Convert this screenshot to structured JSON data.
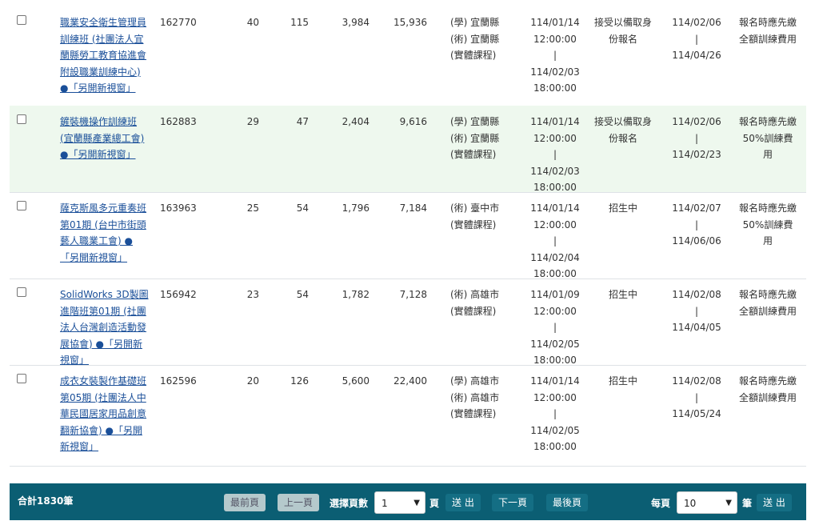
{
  "rows": [
    {
      "name": "職業安全衛生管理員訓練班 (社團法人宜蘭縣勞工教育協進會附設職業訓練中心) ●「另開新視窗」",
      "id": "162770",
      "a": "40",
      "b": "115",
      "c": "3,984",
      "d": "15,936",
      "loc": [
        "(學) 宜蘭縣",
        "(術) 宜蘭縣",
        "(實體課程)"
      ],
      "date": [
        "114/01/14",
        "12:00:00",
        "|",
        "114/02/03",
        "18:00:00"
      ],
      "status": "接受以備取身份報名",
      "period": [
        "114/02/06",
        "|",
        "114/04/26"
      ],
      "pay": "報名時應先繳全額訓練費用"
    },
    {
      "name": "鏟裝機操作訓練班 (宜蘭縣產業總工會) ●「另開新視窗」",
      "id": "162883",
      "a": "29",
      "b": "47",
      "c": "2,404",
      "d": "9,616",
      "loc": [
        "(學) 宜蘭縣",
        "(術) 宜蘭縣",
        "(實體課程)"
      ],
      "date": [
        "114/01/14",
        "12:00:00",
        "|",
        "114/02/03",
        "18:00:00"
      ],
      "status": "接受以備取身份報名",
      "period": [
        "114/02/06",
        "|",
        "114/02/23"
      ],
      "pay": "報名時應先繳50%訓練費用"
    },
    {
      "name": "薩克斯風多元重奏班第01期 (台中市街頭藝人職業工會) ●「另開新視窗」",
      "id": "163963",
      "a": "25",
      "b": "54",
      "c": "1,796",
      "d": "7,184",
      "loc": [
        "(術) 臺中市",
        "(實體課程)"
      ],
      "date": [
        "114/01/14",
        "12:00:00",
        "|",
        "114/02/04",
        "18:00:00"
      ],
      "status": "招生中",
      "period": [
        "114/02/07",
        "|",
        "114/06/06"
      ],
      "pay": "報名時應先繳50%訓練費用"
    },
    {
      "name": "SolidWorks 3D製圖進階班第01期 (社團法人台灣創造活動發展協會) ●「另開新視窗」",
      "id": "156942",
      "a": "23",
      "b": "54",
      "c": "1,782",
      "d": "7,128",
      "loc": [
        "(術) 高雄市",
        "(實體課程)"
      ],
      "date": [
        "114/01/09",
        "12:00:00",
        "|",
        "114/02/05",
        "18:00:00"
      ],
      "status": "招生中",
      "period": [
        "114/02/08",
        "|",
        "114/04/05"
      ],
      "pay": "報名時應先繳全額訓練費用"
    },
    {
      "name": "成衣女裝製作基礎班第05期 (社團法人中華民國居家用品創意翻新協會) ●「另開新視窗」",
      "id": "162596",
      "a": "20",
      "b": "126",
      "c": "5,600",
      "d": "22,400",
      "loc": [
        "(學) 高雄市",
        "(術) 高雄市",
        "(實體課程)"
      ],
      "date": [
        "114/01/14",
        "12:00:00",
        "|",
        "114/02/05",
        "18:00:00"
      ],
      "status": "招生中",
      "period": [
        "114/02/08",
        "|",
        "114/05/24"
      ],
      "pay": "報名時應先繳全額訓練費用"
    }
  ],
  "pager": {
    "total": "合計1830筆",
    "first": "最前頁",
    "prev": "上一頁",
    "select_label": "選擇頁數",
    "page_value": "1",
    "page_unit": "頁",
    "go": "送 出",
    "next": "下一頁",
    "last": "最後頁",
    "per_page_label": "每頁",
    "per_page_value": "10",
    "per_page_unit": "筆",
    "per_page_go": "送 出"
  }
}
